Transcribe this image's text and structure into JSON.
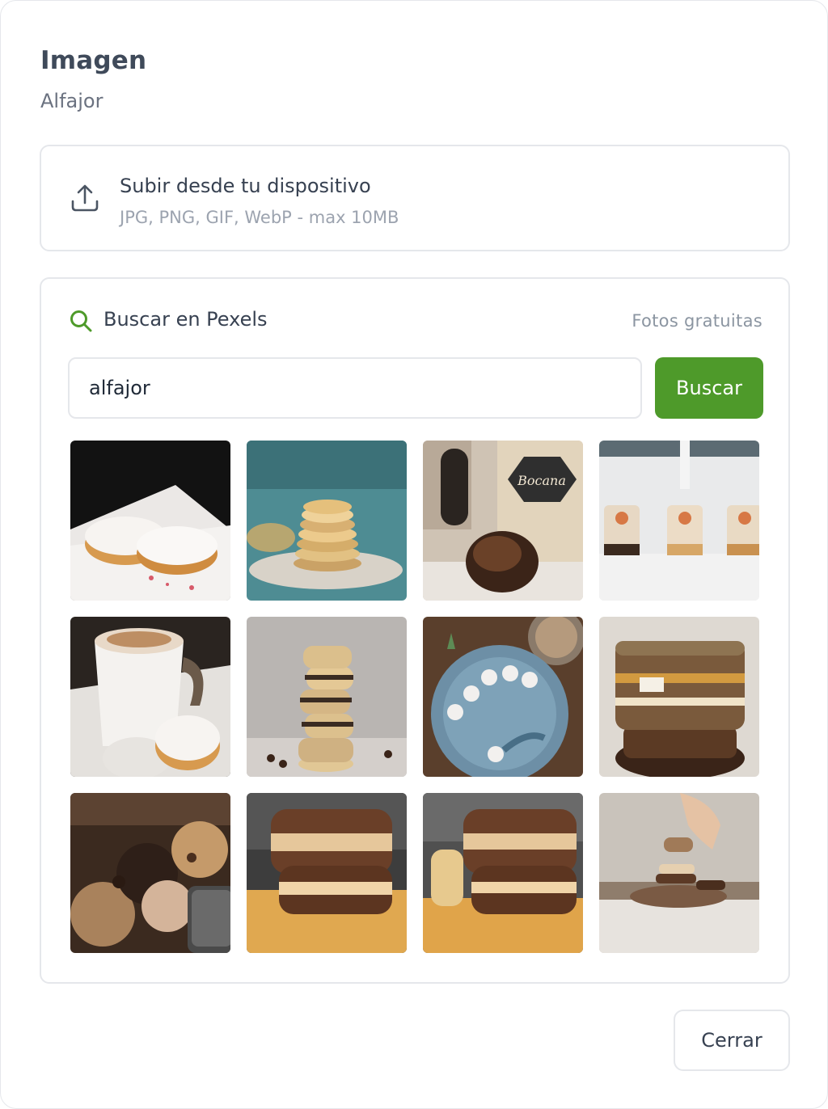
{
  "dialog": {
    "title": "Imagen",
    "subtitle": "Alfajor"
  },
  "upload": {
    "icon": "upload-icon",
    "title": "Subir desde tu dispositivo",
    "hint": "JPG, PNG, GIF, WebP - max 10MB"
  },
  "pexels": {
    "icon": "search-icon",
    "title": "Buscar en Pexels",
    "tag": "Fotos gratuitas",
    "query": "alfajor",
    "search_label": "Buscar",
    "accent_color": "#4e9a2a",
    "results_count": 12
  },
  "footer": {
    "close_label": "Cerrar"
  }
}
